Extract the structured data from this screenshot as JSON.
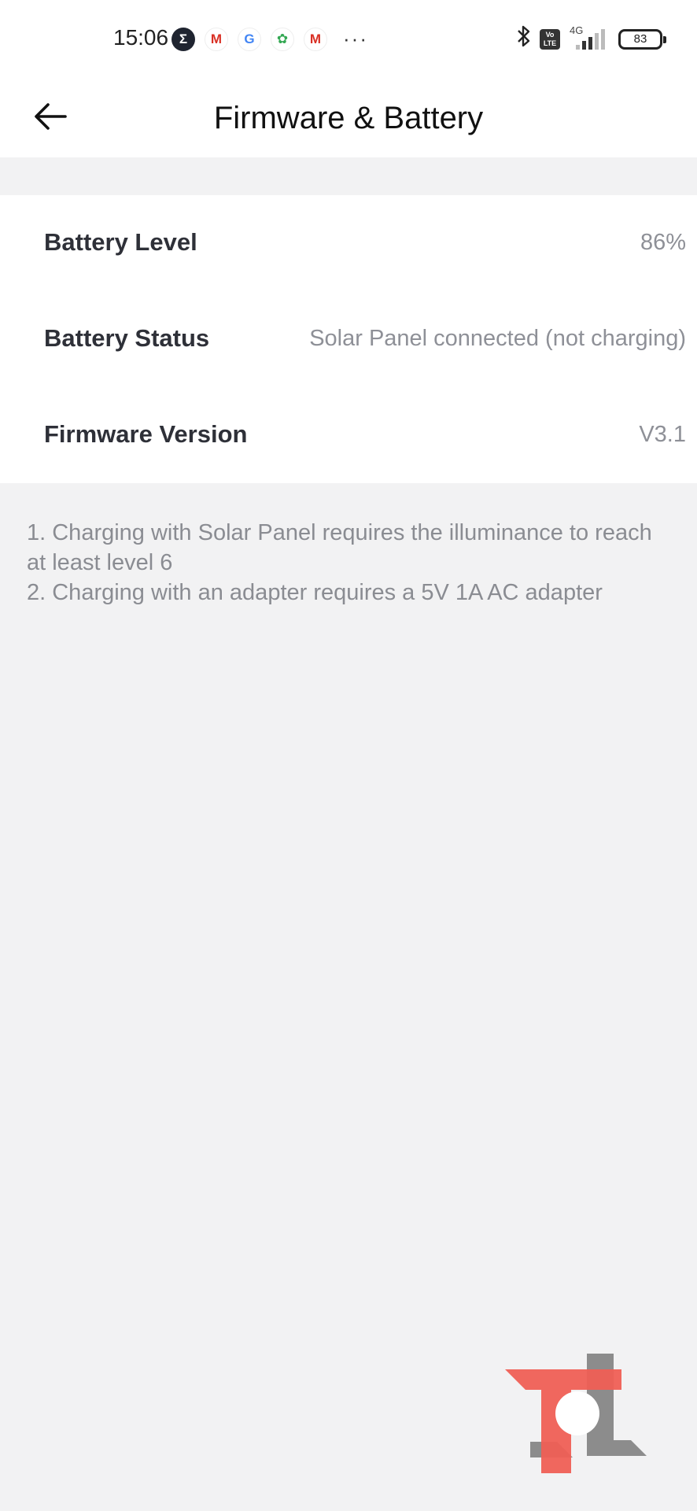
{
  "status_bar": {
    "time": "15:06",
    "notification_icons": [
      "sigma-icon",
      "gmail-icon",
      "google-icon",
      "globe-icon",
      "gmail-icon"
    ],
    "more": "···",
    "network": "4G",
    "volte": "Vo LTE",
    "battery": "83"
  },
  "header": {
    "title": "Firmware & Battery"
  },
  "info": {
    "battery_level": {
      "label": "Battery Level",
      "value": "86%"
    },
    "battery_status": {
      "label": "Battery Status",
      "value": "Solar Panel connected (not charging)"
    },
    "firmware_version": {
      "label": "Firmware Version",
      "value": "V3.1"
    }
  },
  "notes": [
    "1. Charging with Solar Panel requires the illuminance to reach at least level 6",
    "2. Charging with an adapter requires a 5V 1A AC adapter"
  ],
  "colors": {
    "background": "#f2f2f3",
    "card": "#ffffff",
    "label": "#2e3038",
    "value": "#8e9097",
    "watermark_red": "#ef5f55",
    "watermark_gray": "#8c8c8c"
  }
}
